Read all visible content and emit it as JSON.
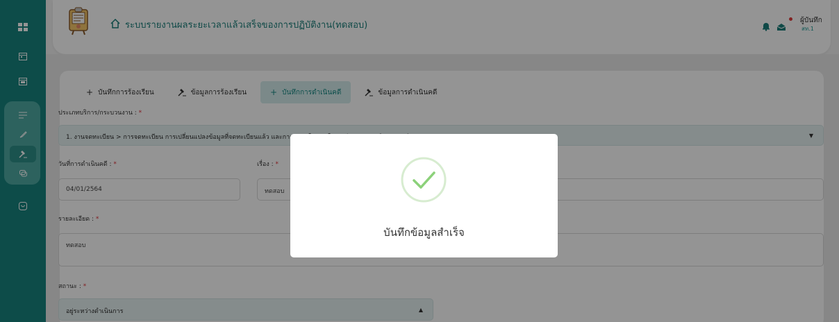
{
  "header": {
    "title": "ระบบรายงานผลระยะเวลาแล้วเสร็จของการปฏิบัติงาน(ทดสอบ)",
    "user_name": "ผู้บันทึก",
    "user_role": "สท.1"
  },
  "tabs": [
    {
      "label": "บันทึกการร้องเรียน",
      "icon": "plus-icon"
    },
    {
      "label": "ข้อมูลการร้องเรียน",
      "icon": "gavel-icon"
    },
    {
      "label": "บันทึกการดำเนินคดี",
      "icon": "plus-icon",
      "active": true
    },
    {
      "label": "ข้อมูลการดำเนินคดี",
      "icon": "gavel-icon"
    }
  ],
  "form": {
    "service_label": "ประเภทบริการ/กระบวนงาน :",
    "service_value": "1. งานจดทะเบียน > การจดทะเบียน การเปลี่ยนแปลงข้อมูลที่จดทะเบียนแล้ว และการขอรับใบแทนใบทะเบียนสรรพสามิต (3 วันทำการ)",
    "date_label": "วันที่การดำเนินคดี :",
    "date_value": "04/01/2564",
    "subject_label": "เรื่อง :",
    "subject_value": "ทดสอบ",
    "detail_label": "รายละเอียด :",
    "detail_value": "ทดสอบ",
    "status_label": "สถานะ :",
    "status_value": "อยู่ระหว่างดำเนินการ",
    "required_mark": "*"
  },
  "modal": {
    "message": "บันทึกข้อมูลสำเร็จ"
  },
  "colors": {
    "rail": "#18837e",
    "accent": "#1a8a85",
    "success": "#8cd17a"
  }
}
